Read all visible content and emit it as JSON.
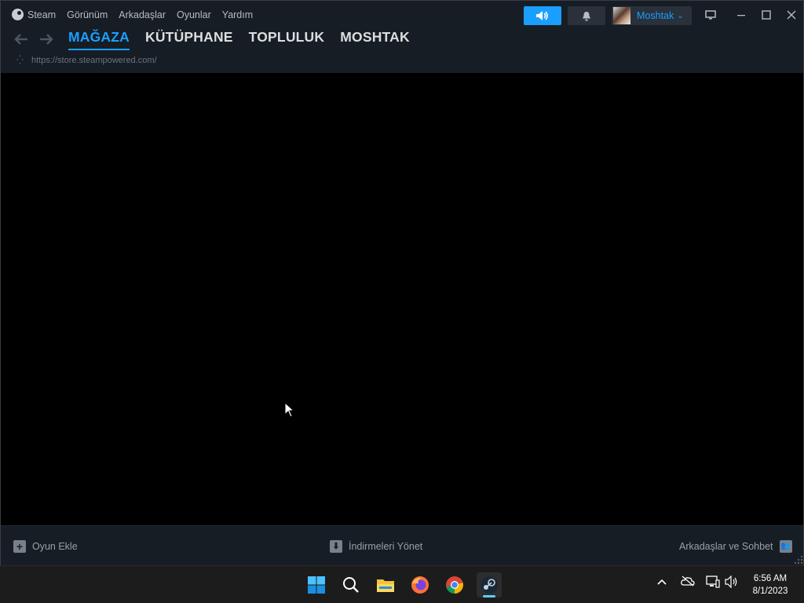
{
  "menu": {
    "steam": "Steam",
    "view": "Görünüm",
    "friends": "Arkadaşlar",
    "games": "Oyunlar",
    "help": "Yardım"
  },
  "tabs": [
    {
      "label": "MAĞAZA",
      "active": true
    },
    {
      "label": "KÜTÜPHANE",
      "active": false
    },
    {
      "label": "TOPLULUK",
      "active": false
    },
    {
      "label": "MOSHTAK",
      "active": false
    }
  ],
  "url": "https://store.steampowered.com/",
  "user": {
    "name": "Moshtak"
  },
  "bottom": {
    "add_game": "Oyun Ekle",
    "downloads": "İndirmeleri Yönet",
    "friends_chat": "Arkadaşlar ve Sohbet"
  },
  "taskbar": {
    "time": "6:56 AM",
    "date": "8/1/2023"
  },
  "colors": {
    "accent": "#1a9fff",
    "titlebar": "#171d25",
    "taskbar": "#1c1c1c"
  }
}
